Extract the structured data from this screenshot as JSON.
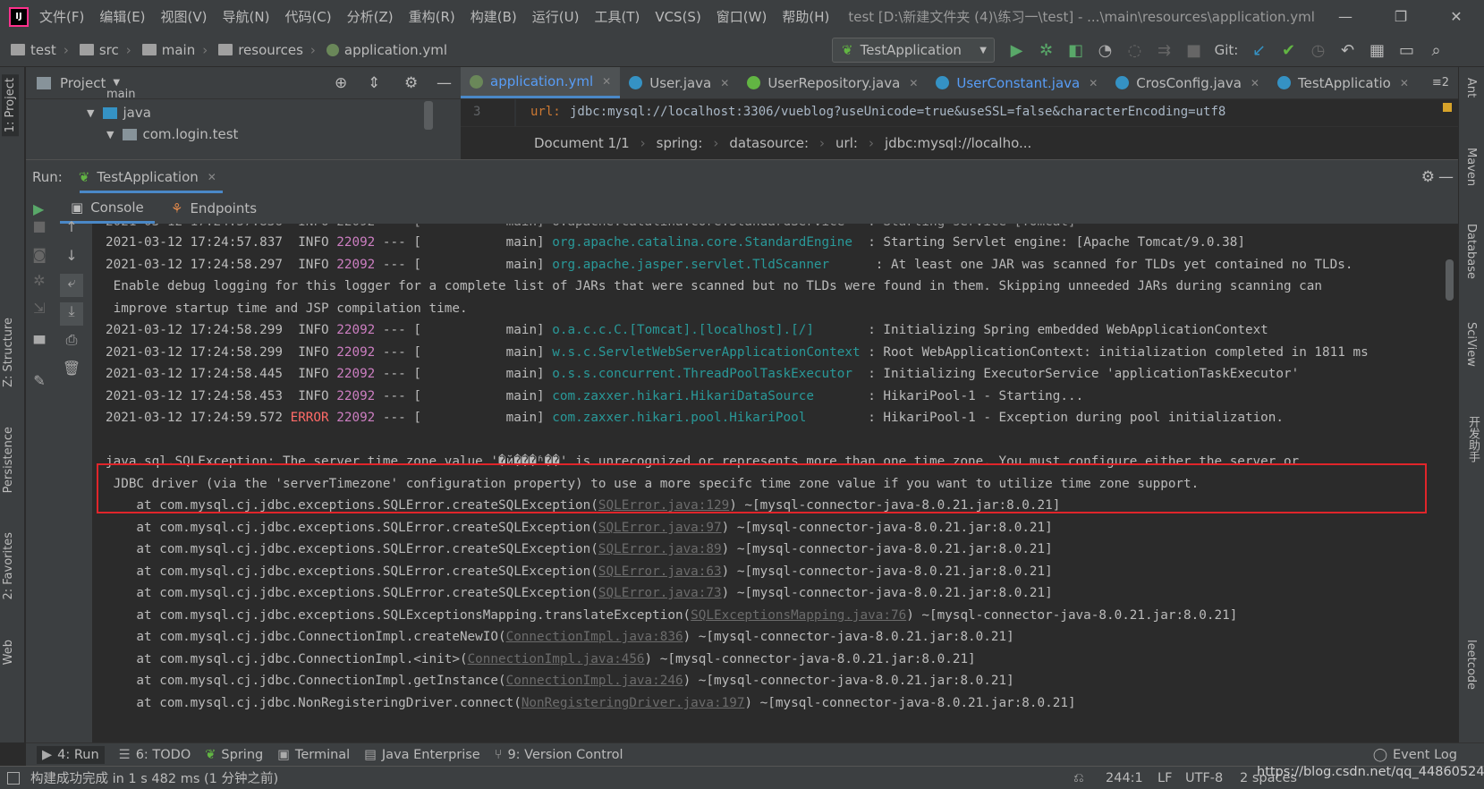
{
  "titlebar": {
    "menu": [
      "文件(F)",
      "编辑(E)",
      "视图(V)",
      "导航(N)",
      "代码(C)",
      "分析(Z)",
      "重构(R)",
      "构建(B)",
      "运行(U)",
      "工具(T)",
      "VCS(S)",
      "窗口(W)",
      "帮助(H)"
    ],
    "title": "test [D:\\新建文件夹 (4)\\练习一\\test] - ...\\main\\resources\\application.yml",
    "minimize": "—",
    "restore": "❐",
    "close": "✕"
  },
  "navbar": {
    "crumbs": [
      "test",
      "src",
      "main",
      "resources",
      "application.yml"
    ],
    "run_config": "TestApplication",
    "git_label": "Git:"
  },
  "project_panel": {
    "title": "Project",
    "tree": [
      "main",
      "java",
      "com.login.test"
    ]
  },
  "editor": {
    "tabs": [
      {
        "label": "application.yml",
        "color": "#6a8759"
      },
      {
        "label": "User.java",
        "color": "#3592c4"
      },
      {
        "label": "UserRepository.java",
        "color": "#62b543"
      },
      {
        "label": "UserConstant.java",
        "color": "#3592c4"
      },
      {
        "label": "CrosConfig.java",
        "color": "#3592c4"
      },
      {
        "label": "TestApplicatio",
        "color": "#3592c4"
      }
    ],
    "tab_overflow": "≡2",
    "line_number": "3",
    "line_key": "url:",
    "line_value": "jdbc:mysql://localhost:3306/vueblog?useUnicode=true&useSSL=false&characterEncoding=utf8",
    "breadcrumbs": [
      "Document 1/1",
      "spring:",
      "datasource:",
      "url:",
      "jdbc:mysql://localho..."
    ]
  },
  "run_panel": {
    "label": "Run:",
    "tab": "TestApplication",
    "subtabs": [
      "Console",
      "Endpoints"
    ]
  },
  "console": {
    "partial_top": "2021-03-12 17:24:57.836  INFO 22092 --- [           main] o.apache.catalina.core.StandardService   : Starting service [Tomcat]",
    "logs": [
      {
        "time": "2021-03-12 17:24:57.837",
        "level": "INFO",
        "pid": "22092",
        "thread": "--- [           main] ",
        "logger": "org.apache.catalina.core.StandardEngine ",
        "msg": " : Starting Servlet engine: [Apache Tomcat/9.0.38]"
      },
      {
        "time": "2021-03-12 17:24:58.297",
        "level": "INFO",
        "pid": "22092",
        "thread": "--- [           main] ",
        "logger": "org.apache.jasper.servlet.TldScanner     ",
        "msg": " : At least one JAR was scanned for TLDs yet contained no TLDs."
      }
    ],
    "cont1": " Enable debug logging for this logger for a complete list of JARs that were scanned but no TLDs were found in them. Skipping unneeded JARs during scanning can",
    "cont2": " improve startup time and JSP compilation time.",
    "logs2": [
      {
        "time": "2021-03-12 17:24:58.299",
        "level": "INFO",
        "pid": "22092",
        "thread": "--- [           main] ",
        "logger": "o.a.c.c.C.[Tomcat].[localhost].[/]      ",
        "msg": " : Initializing Spring embedded WebApplicationContext"
      },
      {
        "time": "2021-03-12 17:24:58.299",
        "level": "INFO",
        "pid": "22092",
        "thread": "--- [           main] ",
        "logger": "w.s.c.ServletWebServerApplicationContext",
        "msg": " : Root WebApplicationContext: initialization completed in 1811 ms"
      },
      {
        "time": "2021-03-12 17:24:58.445",
        "level": "INFO",
        "pid": "22092",
        "thread": "--- [           main] ",
        "logger": "o.s.s.concurrent.ThreadPoolTaskExecutor ",
        "msg": " : Initializing ExecutorService 'applicationTaskExecutor'"
      },
      {
        "time": "2021-03-12 17:24:58.453",
        "level": "INFO",
        "pid": "22092",
        "thread": "--- [           main] ",
        "logger": "com.zaxxer.hikari.HikariDataSource      ",
        "msg": " : HikariPool-1 - Starting..."
      },
      {
        "time": "2021-03-12 17:24:59.572",
        "level": "ERROR",
        "pid": "22092",
        "thread": "--- [           main] ",
        "logger": "com.zaxxer.hikari.pool.HikariPool       ",
        "msg": " : HikariPool-1 - Exception during pool initialization."
      }
    ],
    "exception1": "java.sql.SQLException: The server time zone value '�й���׼ʱ��' is unrecognized or represents more than one time zone. You must configure either the server or",
    "exception2": " JDBC driver (via the 'serverTimezone' configuration property) to use a more specifc time zone value if you want to utilize time zone support.",
    "stack": [
      {
        "pre": "    at com.mysql.cj.jdbc.exceptions.SQLError.createSQLException(",
        "link": "SQLError.java:129",
        "post": ") ~[mysql-connector-java-8.0.21.jar:8.0.21]"
      },
      {
        "pre": "    at com.mysql.cj.jdbc.exceptions.SQLError.createSQLException(",
        "link": "SQLError.java:97",
        "post": ") ~[mysql-connector-java-8.0.21.jar:8.0.21]"
      },
      {
        "pre": "    at com.mysql.cj.jdbc.exceptions.SQLError.createSQLException(",
        "link": "SQLError.java:89",
        "post": ") ~[mysql-connector-java-8.0.21.jar:8.0.21]"
      },
      {
        "pre": "    at com.mysql.cj.jdbc.exceptions.SQLError.createSQLException(",
        "link": "SQLError.java:63",
        "post": ") ~[mysql-connector-java-8.0.21.jar:8.0.21]"
      },
      {
        "pre": "    at com.mysql.cj.jdbc.exceptions.SQLError.createSQLException(",
        "link": "SQLError.java:73",
        "post": ") ~[mysql-connector-java-8.0.21.jar:8.0.21]"
      },
      {
        "pre": "    at com.mysql.cj.jdbc.exceptions.SQLExceptionsMapping.translateException(",
        "link": "SQLExceptionsMapping.java:76",
        "post": ") ~[mysql-connector-java-8.0.21.jar:8.0.21]"
      },
      {
        "pre": "    at com.mysql.cj.jdbc.ConnectionImpl.createNewIO(",
        "link": "ConnectionImpl.java:836",
        "post": ") ~[mysql-connector-java-8.0.21.jar:8.0.21]"
      },
      {
        "pre": "    at com.mysql.cj.jdbc.ConnectionImpl.<init>(",
        "link": "ConnectionImpl.java:456",
        "post": ") ~[mysql-connector-java-8.0.21.jar:8.0.21]"
      },
      {
        "pre": "    at com.mysql.cj.jdbc.ConnectionImpl.getInstance(",
        "link": "ConnectionImpl.java:246",
        "post": ") ~[mysql-connector-java-8.0.21.jar:8.0.21]"
      },
      {
        "pre": "    at com.mysql.cj.jdbc.NonRegisteringDriver.connect(",
        "link": "NonRegisteringDriver.java:197",
        "post": ") ~[mysql-connector-java-8.0.21.jar:8.0.21]"
      }
    ]
  },
  "left_strip": [
    "1: Project",
    "Z: Structure",
    "Persistence",
    "2: Favorites",
    "Web"
  ],
  "right_strip": [
    "Ant",
    "Maven",
    "Database",
    "SciView",
    "开发助手",
    "leetcode"
  ],
  "bottom_tabs": [
    {
      "label": "4: Run",
      "icon": "▶"
    },
    {
      "label": "6: TODO",
      "icon": "☰"
    },
    {
      "label": "Spring",
      "icon": "❦"
    },
    {
      "label": "Terminal",
      "icon": "▣"
    },
    {
      "label": "Java Enterprise",
      "icon": "▤"
    },
    {
      "label": "9: Version Control",
      "icon": "⑂"
    }
  ],
  "event_log": "Event Log",
  "status": {
    "message": "构建成功完成 in 1 s 482 ms (1 分钟之前)",
    "position": "244:1",
    "line_sep": "LF",
    "encoding": "UTF-8",
    "indent": "2 spaces",
    "watermark": "https://blog.csdn.net/qq_44860524"
  },
  "colors": {
    "accent": "#4a88c7",
    "error": "#ff6b68",
    "logger": "#299999",
    "pid": "#cc7ec1",
    "highlight_box": "#e0252a"
  }
}
